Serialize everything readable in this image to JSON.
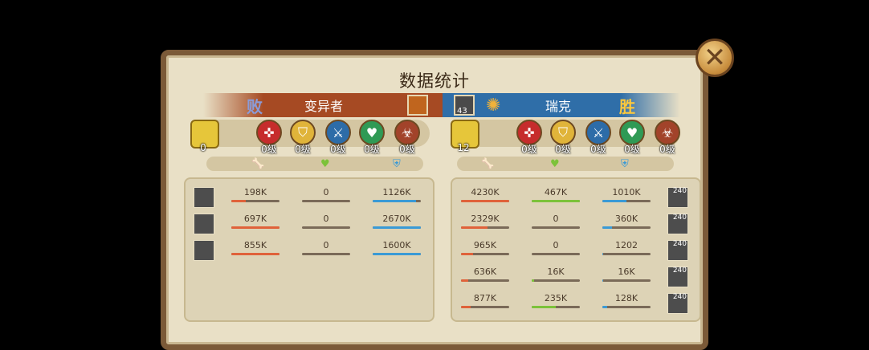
{
  "title": "数据统计",
  "close_icon": "close-icon",
  "left_team": {
    "result": "败",
    "name": "变异者",
    "badges": [
      {
        "icon": "gold-hex-icon",
        "label": "0",
        "color": "#e6c63a"
      },
      {
        "icon": "red-crosshair-icon",
        "label": "0级",
        "color": "#c62c2c"
      },
      {
        "icon": "gold-shield-icon",
        "label": "0级",
        "color": "#e0b43a"
      },
      {
        "icon": "blue-axe-icon",
        "label": "0级",
        "color": "#2d6ca8"
      },
      {
        "icon": "green-heart-icon",
        "label": "0级",
        "color": "#2f9a55"
      },
      {
        "icon": "biohazard-icon",
        "label": "0级",
        "color": "#a2432a"
      }
    ],
    "rows": [
      {
        "level": "",
        "vals": [
          "198K",
          "0",
          "1126K"
        ],
        "fills": [
          0.3,
          0,
          0.9
        ]
      },
      {
        "level": "",
        "vals": [
          "697K",
          "0",
          "2670K"
        ],
        "fills": [
          1.0,
          0,
          1.0
        ]
      },
      {
        "level": "",
        "vals": [
          "855K",
          "0",
          "1600K"
        ],
        "fills": [
          1.0,
          0,
          1.0
        ]
      }
    ]
  },
  "right_team": {
    "result": "胜",
    "name": "瑞克",
    "avatar_level": "43",
    "badges": [
      {
        "icon": "gold-hex-icon",
        "label": "12",
        "color": "#e6c63a"
      },
      {
        "icon": "red-crosshair-icon",
        "label": "0级",
        "color": "#c62c2c"
      },
      {
        "icon": "gold-shield-icon",
        "label": "0级",
        "color": "#e0b43a"
      },
      {
        "icon": "blue-axe-icon",
        "label": "0级",
        "color": "#2d6ca8"
      },
      {
        "icon": "green-heart-icon",
        "label": "0级",
        "color": "#2f9a55"
      },
      {
        "icon": "biohazard-icon",
        "label": "0级",
        "color": "#a2432a"
      }
    ],
    "rows": [
      {
        "level": "240",
        "vals": [
          "4230K",
          "467K",
          "1010K"
        ],
        "fills": [
          1.0,
          1.0,
          0.5
        ]
      },
      {
        "level": "240",
        "vals": [
          "2329K",
          "0",
          "360K"
        ],
        "fills": [
          0.55,
          0,
          0.2
        ]
      },
      {
        "level": "240",
        "vals": [
          "965K",
          "0",
          "1202"
        ],
        "fills": [
          0.25,
          0,
          0.02
        ]
      },
      {
        "level": "240",
        "vals": [
          "636K",
          "16K",
          "16K"
        ],
        "fills": [
          0.15,
          0.05,
          0.02
        ]
      },
      {
        "level": "240",
        "vals": [
          "877K",
          "235K",
          "128K"
        ],
        "fills": [
          0.2,
          0.5,
          0.1
        ]
      }
    ]
  },
  "stat_icons": {
    "damage": "bone-damage-icon",
    "heal": "green-heart-icon",
    "shield": "blue-shield-icon"
  },
  "colors": {
    "damage": "#e0623a",
    "heal": "#7cc23a",
    "shield": "#3a9ad6"
  }
}
